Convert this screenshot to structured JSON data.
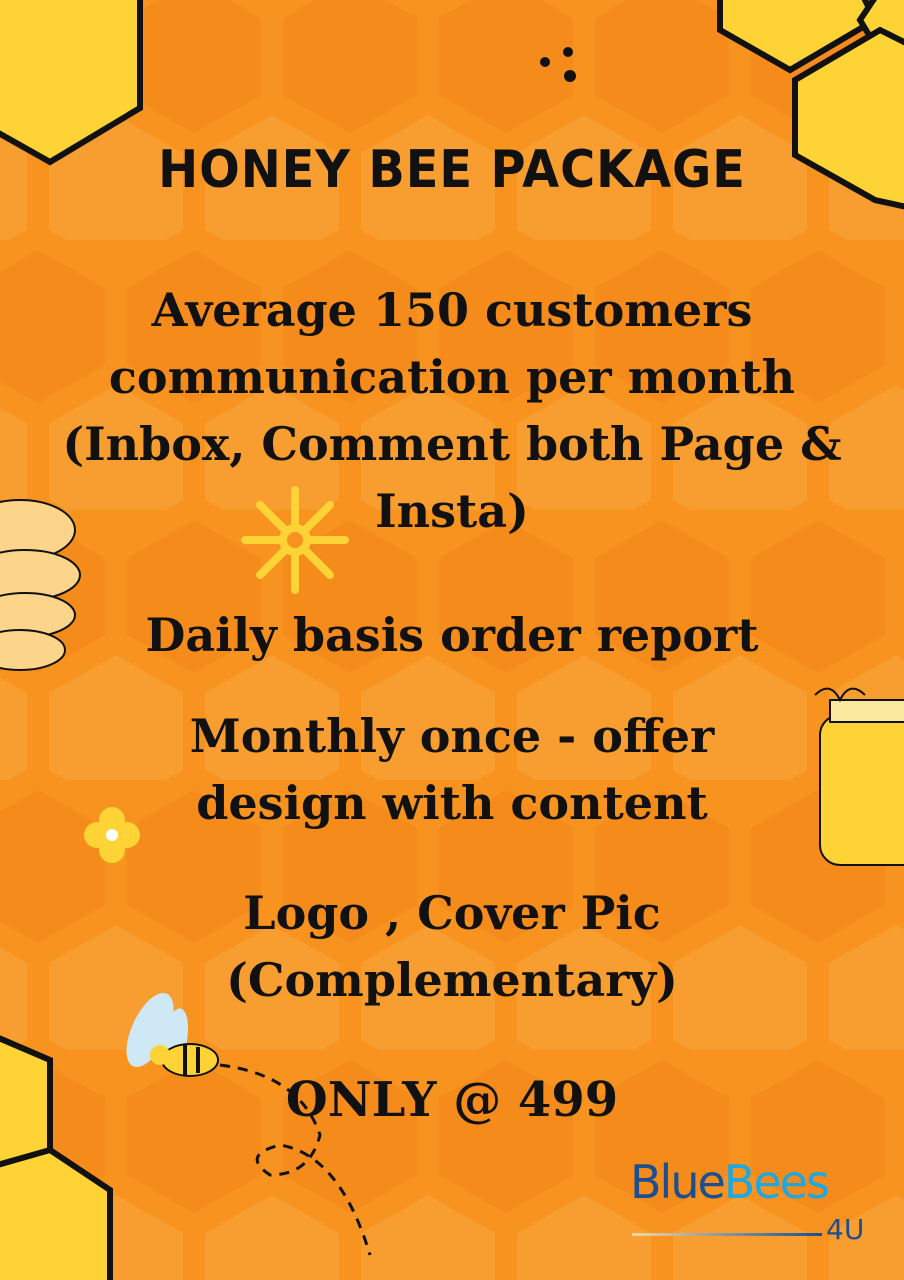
{
  "title": "HONEY BEE PACKAGE",
  "features": [
    [
      "Average 150 customers",
      "communication per month",
      "(Inbox, Comment both Page &",
      "Insta)"
    ],
    [
      "Daily basis order report"
    ],
    [
      "Monthly once -  offer",
      "design with content"
    ],
    [
      "Logo , Cover Pic",
      "(Complementary)"
    ]
  ],
  "price": "ONLY @ 499",
  "logo": {
    "part1": "Blue",
    "part2": "Bees",
    "suffix": "4U"
  },
  "colors": {
    "background": "#F7931E",
    "honeycomb": "#FDD335",
    "logo_dark": "#1B4F8F",
    "logo_light": "#1EA7E1"
  }
}
